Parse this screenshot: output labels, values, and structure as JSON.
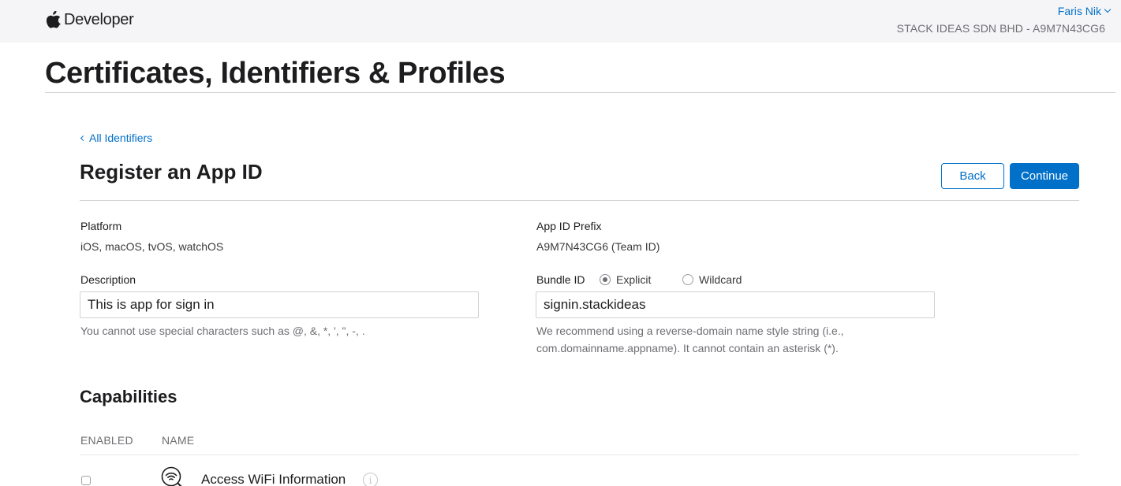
{
  "header": {
    "brand": "Developer",
    "user_name": "Faris Nik",
    "team": "STACK IDEAS SDN BHD - A9M7N43CG6"
  },
  "page": {
    "title": "Certificates, Identifiers & Profiles"
  },
  "nav": {
    "back_link": "All Identifiers"
  },
  "form": {
    "title": "Register an App ID",
    "buttons": {
      "back": "Back",
      "continue": "Continue"
    },
    "platform": {
      "label": "Platform",
      "value": "iOS, macOS, tvOS, watchOS"
    },
    "app_id_prefix": {
      "label": "App ID Prefix",
      "value": "A9M7N43CG6 (Team ID)"
    },
    "description": {
      "label": "Description",
      "value": "This is app for sign in",
      "helper": "You cannot use special characters such as @, &, *, ', \", -, ."
    },
    "bundle_id": {
      "label": "Bundle ID",
      "options": [
        "Explicit",
        "Wildcard"
      ],
      "selected": "Explicit",
      "value": "signin.stackideas",
      "helper_line1": "We recommend using a reverse-domain name style string (i.e.,",
      "helper_line2": "com.domainname.appname). It cannot contain an asterisk (*)."
    }
  },
  "capabilities": {
    "title": "Capabilities",
    "columns": {
      "enabled": "ENABLED",
      "name": "NAME"
    },
    "rows": [
      {
        "name": "Access WiFi Information",
        "enabled": false,
        "icon": "wifi-search-icon"
      }
    ]
  },
  "colors": {
    "accent": "#0070c9",
    "header_bg": "#f5f5f7",
    "text": "#1d1d1f",
    "muted": "#6e6e73"
  }
}
